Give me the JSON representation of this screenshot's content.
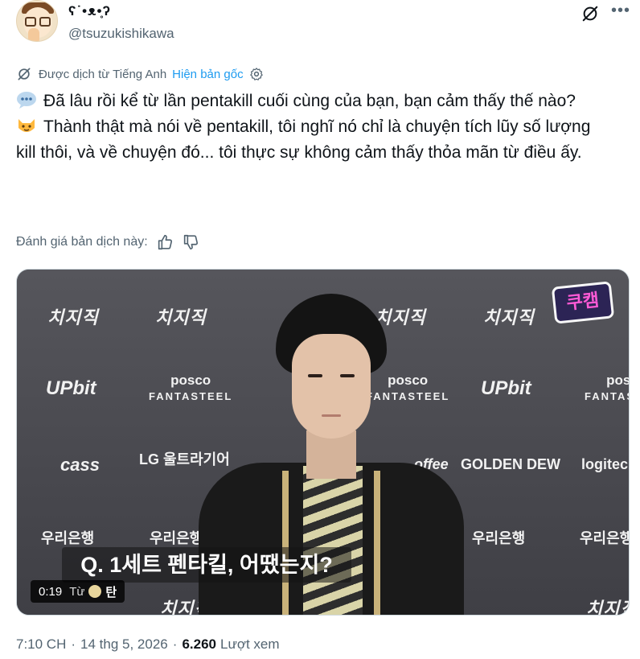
{
  "author": {
    "display_name": "ʕ˙•ᴥ•̥ʔ",
    "handle": "@tsuzukishikawa"
  },
  "header_icons": [
    "grok-icon",
    "more-icon"
  ],
  "translation": {
    "translated_from": "Được dịch từ Tiếng Anh",
    "show_original": "Hiện bản gốc"
  },
  "tweet": {
    "line1": "Đã lâu rồi kể từ lần pentakill cuối cùng của bạn, bạn cảm thấy thế nào?",
    "line2": "Thành thật mà nói về pentakill, tôi nghĩ nó chỉ là chuyện tích lũy số lượng kill thôi, và về chuyện đó... tôi thực sự không cảm thấy thỏa mãn từ điều ấy.",
    "emoji1": "speech-bubble-emoji",
    "emoji2": "cat-face-emoji"
  },
  "rate": {
    "label": "Đánh giá bản dịch này:"
  },
  "media": {
    "subtitle": "Q. 1세트 펜타킬, 어땠는지?",
    "sticker": "쿠캠",
    "sponsors": {
      "chzzk": "치지직",
      "upbit": "UPbit",
      "posco": "posco",
      "posco_sub": "FANTASTEEL",
      "cass": "cass",
      "lg": "LG 울트라기어",
      "golden_dew": "GOLDEN DEW",
      "logitech": "logitech",
      "woori": "우리은행",
      "coffee": "offee"
    },
    "time": "0:19",
    "from_label": "Từ",
    "channel": "탄"
  },
  "meta": {
    "time": "7:10 CH",
    "date": "14 thg 5, 2026",
    "views": "6.260",
    "views_label": "Lượt xem"
  }
}
